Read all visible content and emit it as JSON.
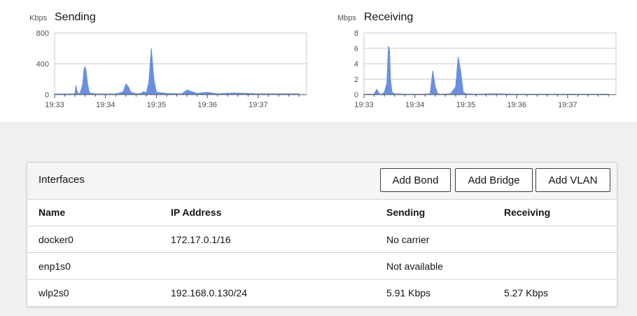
{
  "sending_chart": {
    "title": "Sending",
    "unit": "Kbps",
    "ylim": [
      0,
      800
    ],
    "y_ticks": [
      "800",
      "400",
      "0"
    ],
    "x_ticks": [
      "19:33",
      "19:34",
      "19:35",
      "19:36",
      "19:37"
    ],
    "color": "#6a8fe0"
  },
  "receiving_chart": {
    "title": "Receiving",
    "unit": "Mbps",
    "ylim": [
      0,
      8
    ],
    "y_ticks": [
      "8",
      "6",
      "4",
      "2",
      "0"
    ],
    "x_ticks": [
      "19:33",
      "19:34",
      "19:35",
      "19:36",
      "19:37"
    ],
    "color": "#6a8fe0"
  },
  "chart_data": [
    {
      "type": "area",
      "title": "Sending",
      "ylabel": "Kbps",
      "ylim": [
        0,
        800
      ],
      "x_range": [
        "19:33",
        "19:37"
      ],
      "x": [
        0,
        0.2,
        0.4,
        0.42,
        0.45,
        0.5,
        0.55,
        0.58,
        0.6,
        0.62,
        0.65,
        0.68,
        0.72,
        0.8,
        1.0,
        1.2,
        1.3,
        1.35,
        1.4,
        1.45,
        1.5,
        1.6,
        1.7,
        1.75,
        1.8,
        1.85,
        1.9,
        1.95,
        2.0,
        2.2,
        2.5,
        2.6,
        2.8,
        3.0,
        3.2,
        3.5,
        3.8,
        4.0,
        4.4,
        4.8
      ],
      "y": [
        8,
        8,
        10,
        120,
        20,
        15,
        130,
        340,
        360,
        300,
        130,
        30,
        15,
        10,
        8,
        10,
        25,
        40,
        140,
        100,
        30,
        10,
        15,
        40,
        20,
        150,
        600,
        200,
        30,
        15,
        10,
        60,
        15,
        30,
        10,
        20,
        15,
        10,
        10,
        10
      ]
    },
    {
      "type": "area",
      "title": "Receiving",
      "ylabel": "Mbps",
      "ylim": [
        0,
        8
      ],
      "x_range": [
        "19:33",
        "19:37"
      ],
      "x": [
        0,
        0.2,
        0.25,
        0.3,
        0.35,
        0.4,
        0.45,
        0.48,
        0.5,
        0.52,
        0.55,
        0.6,
        0.8,
        1.0,
        1.2,
        1.3,
        1.35,
        1.4,
        1.45,
        1.5,
        1.7,
        1.8,
        1.85,
        1.9,
        1.95,
        2.0,
        2.2,
        2.5,
        3.0,
        3.5,
        4.0,
        4.4,
        4.8
      ],
      "y": [
        0.05,
        0.05,
        0.7,
        0.1,
        0.05,
        0.3,
        1.5,
        6.3,
        5.8,
        2.0,
        0.3,
        0.1,
        0.05,
        0.05,
        0.05,
        0.1,
        3.1,
        1.0,
        0.1,
        0.05,
        0.1,
        1.0,
        4.9,
        3.0,
        0.3,
        0.1,
        0.05,
        0.1,
        0.05,
        0.05,
        0.05,
        0.05,
        0.05
      ]
    }
  ],
  "interfaces": {
    "title": "Interfaces",
    "buttons": {
      "add_bond": "Add Bond",
      "add_bridge": "Add Bridge",
      "add_vlan": "Add VLAN"
    },
    "columns": {
      "name": "Name",
      "ip": "IP Address",
      "sending": "Sending",
      "receiving": "Receiving"
    },
    "rows": [
      {
        "name": "docker0",
        "ip": "172.17.0.1/16",
        "sending": "No carrier",
        "receiving": ""
      },
      {
        "name": "enp1s0",
        "ip": "",
        "sending": "Not available",
        "receiving": ""
      },
      {
        "name": "wlp2s0",
        "ip": "192.168.0.130/24",
        "sending": "5.91 Kbps",
        "receiving": "5.27 Kbps"
      }
    ]
  }
}
